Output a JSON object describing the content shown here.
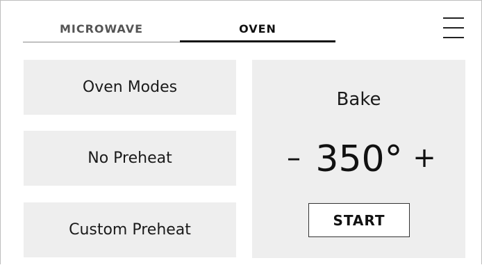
{
  "tabs": {
    "microwave_label": "MICROWAVE",
    "oven_label": "OVEN",
    "active": "OVEN"
  },
  "menu": {
    "icon": "hamburger-menu-icon"
  },
  "modes": [
    {
      "label": "Oven Modes"
    },
    {
      "label": "No Preheat"
    },
    {
      "label": "Custom Preheat"
    }
  ],
  "panel": {
    "mode_title": "Bake",
    "decrease_label": "–",
    "temperature": "350°",
    "increase_label": "+",
    "start_label": "START"
  },
  "colors": {
    "button_bg": "#eeeeee",
    "text": "#111111",
    "inactive_tab_text": "#555555"
  }
}
